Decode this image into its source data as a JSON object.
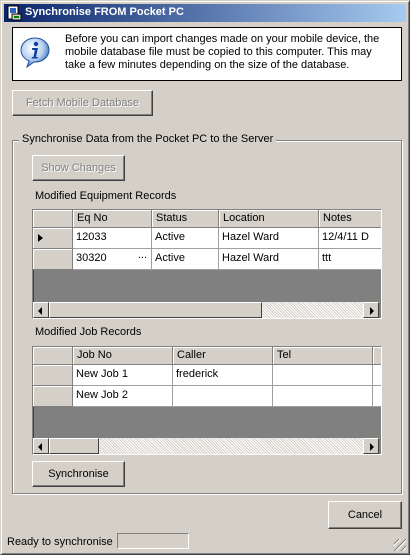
{
  "window": {
    "title": "Synchronise FROM Pocket PC"
  },
  "info": {
    "icon": "info-icon",
    "message": "Before you can import changes made on your mobile device, the mobile database file must be copied to this computer.  This may take a few minutes depending on the size of the database."
  },
  "fetch_button": {
    "label": "Fetch Mobile Database",
    "enabled": false
  },
  "group": {
    "title": "Synchronise Data from the Pocket PC to the Server",
    "show_changes_label": "Show Changes",
    "equipment_label": "Modified Equipment Records",
    "jobs_label": "Modified Job Records",
    "synchronise_label": "Synchronise"
  },
  "equipment_grid": {
    "columns": [
      "Eq No",
      "Status",
      "Location",
      "Notes"
    ],
    "rows": [
      {
        "cells": [
          "12033",
          "Active",
          "Hazel Ward",
          "12/4/11  D"
        ],
        "current": true
      },
      {
        "cells": [
          "30320",
          "Active",
          "Hazel Ward",
          "ttt"
        ],
        "current": false
      }
    ],
    "ellipsis": "..."
  },
  "jobs_grid": {
    "columns": [
      "Job No",
      "Caller",
      "Tel"
    ],
    "rows": [
      {
        "cells": [
          "New Job 1",
          "frederick",
          ""
        ]
      },
      {
        "cells": [
          "New Job 2",
          "",
          ""
        ]
      }
    ]
  },
  "cancel_button": {
    "label": "Cancel"
  },
  "status": {
    "text": "Ready to synchronise"
  }
}
